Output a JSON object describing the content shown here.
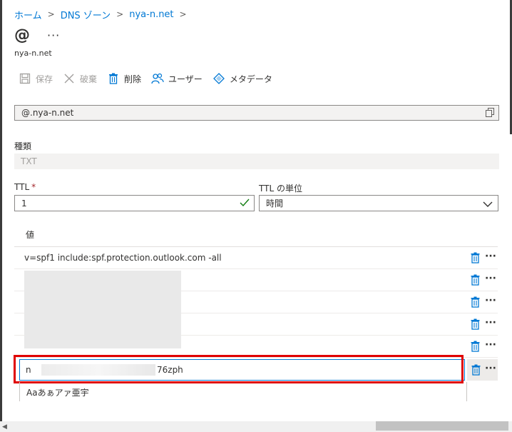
{
  "breadcrumb": {
    "items": [
      "ホーム",
      "DNS ゾーン",
      "nya-n.net"
    ],
    "separator": ">"
  },
  "page": {
    "title": "@",
    "more": "···",
    "subtitle": "nya-n.net"
  },
  "toolbar": {
    "save": "保存",
    "discard": "破棄",
    "delete": "削除",
    "users": "ユーザー",
    "metadata": "メタデータ"
  },
  "record": {
    "name_value": "@.nya-n.net",
    "type_label": "種類",
    "type_value": "TXT",
    "ttl_label": "TTL",
    "ttl_required": "*",
    "ttl_value": "1",
    "ttl_unit_label": "TTL の単位",
    "ttl_unit_value": "時間"
  },
  "values": {
    "header": "値",
    "rows": [
      "v=spf1 include:spf.protection.outlook.com -all",
      "",
      "",
      "",
      ""
    ],
    "active_row_start": "n",
    "active_row_end": "76zph",
    "ime_hint": "Aaあぁアァ亜宇"
  },
  "colors": {
    "accent": "#0078d4",
    "highlight": "#e00000",
    "valid": "#107c10"
  }
}
